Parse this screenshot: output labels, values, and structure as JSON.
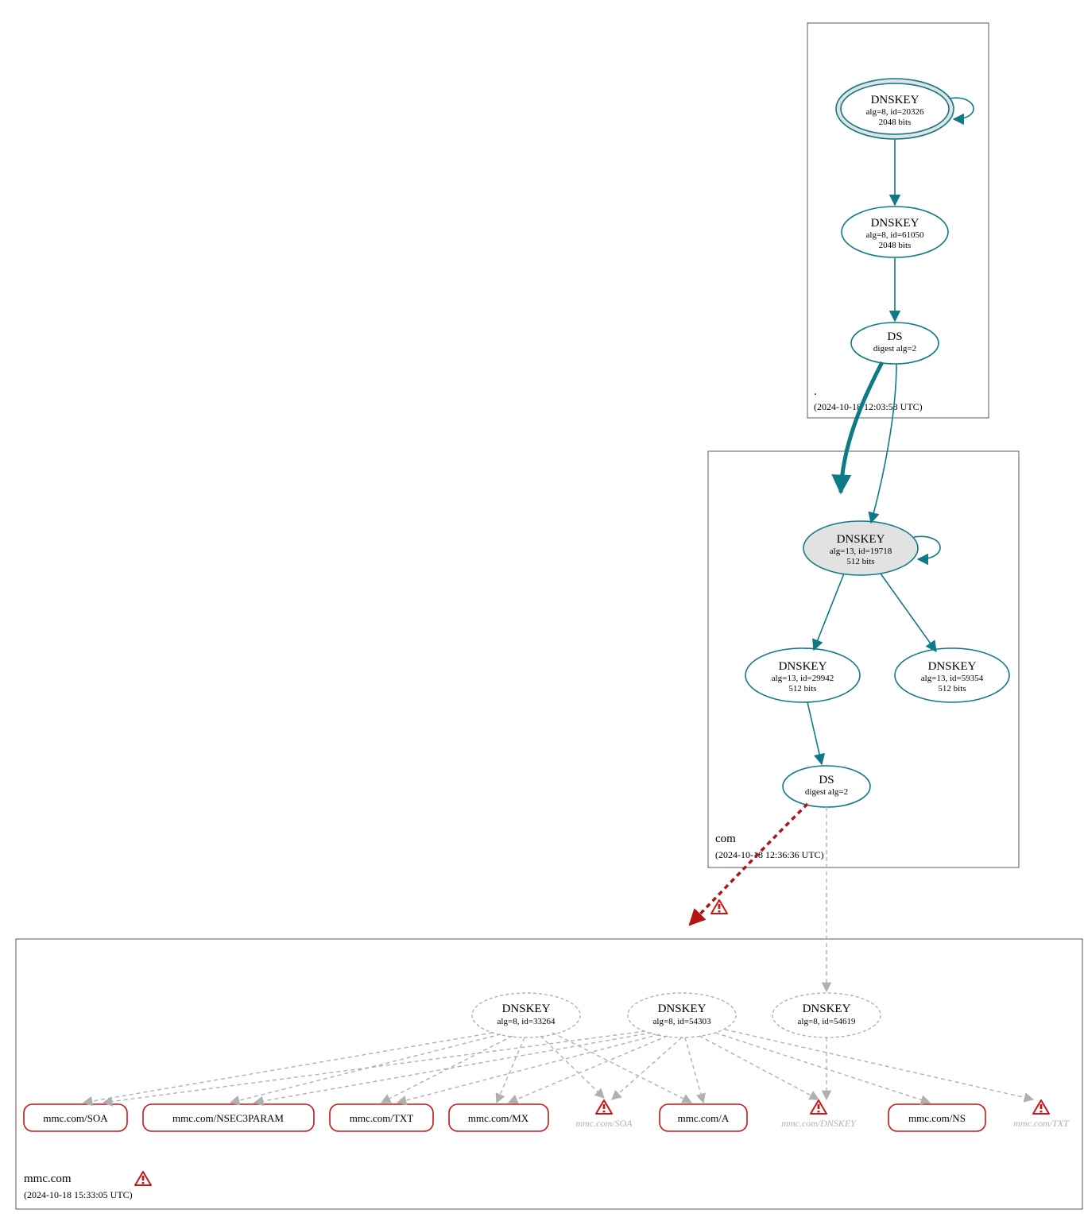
{
  "zones": {
    "root": {
      "label": ".",
      "timestamp": "(2024-10-18 12:03:58 UTC)"
    },
    "com": {
      "label": "com",
      "timestamp": "(2024-10-18 12:36:36 UTC)"
    },
    "mmc": {
      "label": "mmc.com",
      "timestamp": "(2024-10-18 15:33:05 UTC)"
    }
  },
  "nodes": {
    "root_ksk": {
      "title": "DNSKEY",
      "line2": "alg=8, id=20326",
      "line3": "2048 bits"
    },
    "root_zsk": {
      "title": "DNSKEY",
      "line2": "alg=8, id=61050",
      "line3": "2048 bits"
    },
    "root_ds": {
      "title": "DS",
      "line2": "digest alg=2"
    },
    "com_ksk": {
      "title": "DNSKEY",
      "line2": "alg=13, id=19718",
      "line3": "512 bits"
    },
    "com_zsk1": {
      "title": "DNSKEY",
      "line2": "alg=13, id=29942",
      "line3": "512 bits"
    },
    "com_zsk2": {
      "title": "DNSKEY",
      "line2": "alg=13, id=59354",
      "line3": "512 bits"
    },
    "com_ds": {
      "title": "DS",
      "line2": "digest alg=2"
    },
    "mmc_k1": {
      "title": "DNSKEY",
      "line2": "alg=8, id=33264"
    },
    "mmc_k2": {
      "title": "DNSKEY",
      "line2": "alg=8, id=54303"
    },
    "mmc_k3": {
      "title": "DNSKEY",
      "line2": "alg=8, id=54619"
    }
  },
  "rr": {
    "soa": "mmc.com/SOA",
    "nsec3": "mmc.com/NSEC3PARAM",
    "txt": "mmc.com/TXT",
    "mx": "mmc.com/MX",
    "a": "mmc.com/A",
    "ns": "mmc.com/NS"
  },
  "phantoms": {
    "p1": "mmc.com/SOA",
    "p2": "mmc.com/DNSKEY",
    "p3": "mmc.com/TXT"
  }
}
